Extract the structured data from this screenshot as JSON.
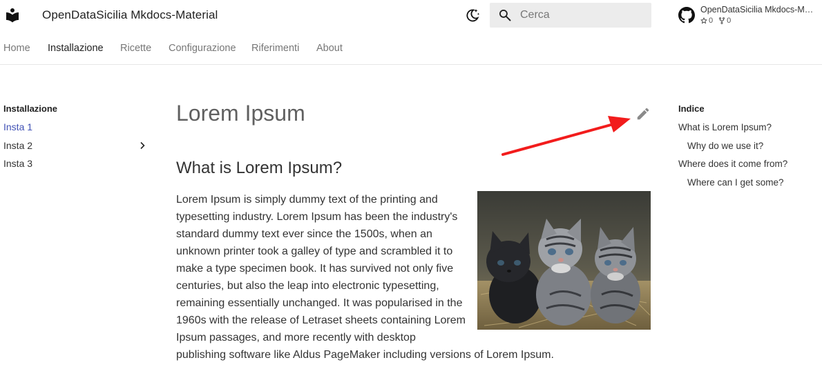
{
  "header": {
    "site_title": "OpenDataSicilia Mkdocs-Material",
    "search_placeholder": "Cerca",
    "repo": {
      "name": "OpenDataSicilia Mkdocs-M…",
      "stars": "0",
      "forks": "0"
    }
  },
  "tabs": [
    {
      "label": "Home"
    },
    {
      "label": "Installazione"
    },
    {
      "label": "Ricette"
    },
    {
      "label": "Configurazione"
    },
    {
      "label": "Riferimenti"
    },
    {
      "label": "About"
    }
  ],
  "sidebar": {
    "title": "Installazione",
    "items": [
      {
        "label": "Insta 1"
      },
      {
        "label": "Insta 2"
      },
      {
        "label": "Insta 3"
      }
    ]
  },
  "content": {
    "title": "Lorem Ipsum",
    "section_heading": "What is Lorem Ipsum?",
    "paragraph": "Lorem Ipsum is simply dummy text of the printing and typesetting industry. Lorem Ipsum has been the industry's standard dummy text ever since the 1500s, when an unknown printer took a galley of type and scrambled it to make a type specimen book. It has survived not only five centuries, but also the leap into electronic typesetting, remaining essentially unchanged. It was popularised in the 1960s with the release of Letraset sheets containing Lorem Ipsum passages, and more recently with desktop publishing software like Aldus PageMaker including versions of Lorem Ipsum."
  },
  "toc": {
    "title": "Indice",
    "items": [
      {
        "label": "What is Lorem Ipsum?"
      },
      {
        "label": "Why do we use it?"
      },
      {
        "label": "Where does it come from?"
      },
      {
        "label": "Where can I get some?"
      }
    ]
  },
  "colors": {
    "accent": "#4051b5",
    "annotation_arrow": "#f21c1c"
  },
  "icons": [
    "book-logo-icon",
    "theme-toggle-icon",
    "search-icon",
    "github-icon",
    "star-icon",
    "fork-icon",
    "chevron-right-icon",
    "edit-pencil-icon"
  ]
}
